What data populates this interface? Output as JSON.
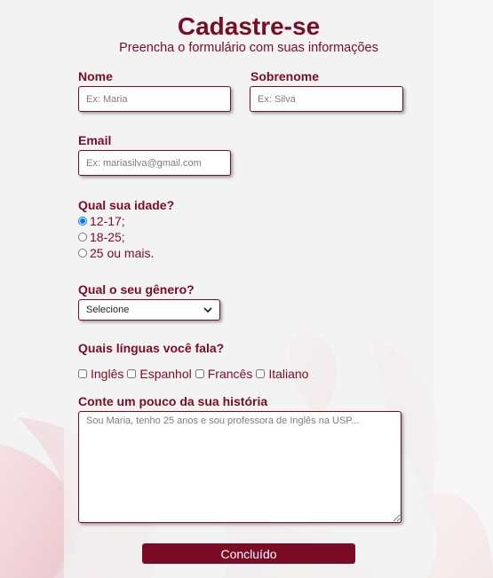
{
  "form": {
    "title": "Cadastre-se",
    "subtitle": "Preencha o formulário com suas informações",
    "first_name": {
      "label": "Nome",
      "placeholder": "Ex: Maria"
    },
    "last_name": {
      "label": "Sobrenome",
      "placeholder": "Ex: Silva"
    },
    "email": {
      "label": "Email",
      "placeholder": "Ex: mariasilva@gmail.com"
    },
    "age": {
      "label": "Qual sua idade?",
      "options": [
        "12-17;",
        "18-25;",
        "25 ou mais."
      ],
      "selected_index": 0
    },
    "gender": {
      "label": "Qual o seu gênero?",
      "selected": "Selecione",
      "icon": "chevron-down-icon"
    },
    "languages": {
      "label": "Quais línguas você fala?",
      "options": [
        "Inglês",
        "Espanhol",
        "Francês",
        "Italiano"
      ]
    },
    "story": {
      "label": "Conte um pouco da sua história",
      "placeholder": "Sou Maria, tenho 25 anos e sou professora de Inglês na USP..."
    },
    "submit_label": "Concluído"
  },
  "colors": {
    "accent": "#7a0c25",
    "background": "#f4f3f3"
  }
}
